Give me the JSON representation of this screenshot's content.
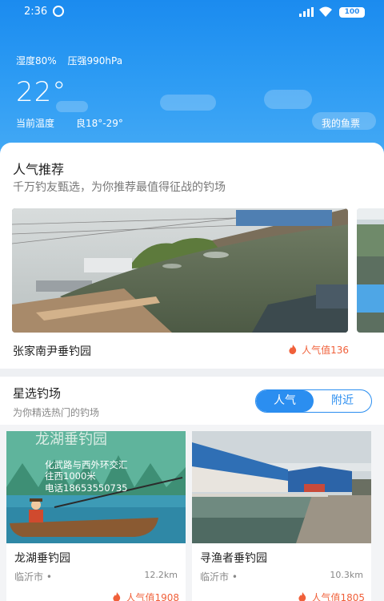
{
  "status_bar": {
    "time": "2:36",
    "battery": "100"
  },
  "weather": {
    "humidity": "湿度80%",
    "pressure": "压强990hPa",
    "temperature": "22°",
    "temp_label": "当前温度",
    "temp_range": "良18°-29°",
    "my_ticket": "我的鱼票"
  },
  "recommend": {
    "title": "人气推荐",
    "subtitle": "千万钓友甄选，为你推荐最值得征战的钓场",
    "spot_name": "张家南尹垂钓园",
    "popularity": "人气值136"
  },
  "selected": {
    "title": "星选钓场",
    "subtitle": "为你精选热门的钓场",
    "tabs": [
      "人气",
      "附近"
    ],
    "items": [
      {
        "name": "龙湖垂钓园",
        "city": "临沂市 •",
        "distance": "12.2km",
        "popularity": "人气值1908",
        "poster_title": "龙湖垂钓园",
        "poster_line1": "化武路与西外环交汇",
        "poster_line2": "往西1000米",
        "poster_line3": "电话18653550735"
      },
      {
        "name": "寻渔者垂钓园",
        "city": "临沂市 •",
        "distance": "10.3km",
        "popularity": "人气值1805"
      }
    ]
  },
  "colors": {
    "accent": "#2b8ef0",
    "hot": "#f0603a"
  }
}
